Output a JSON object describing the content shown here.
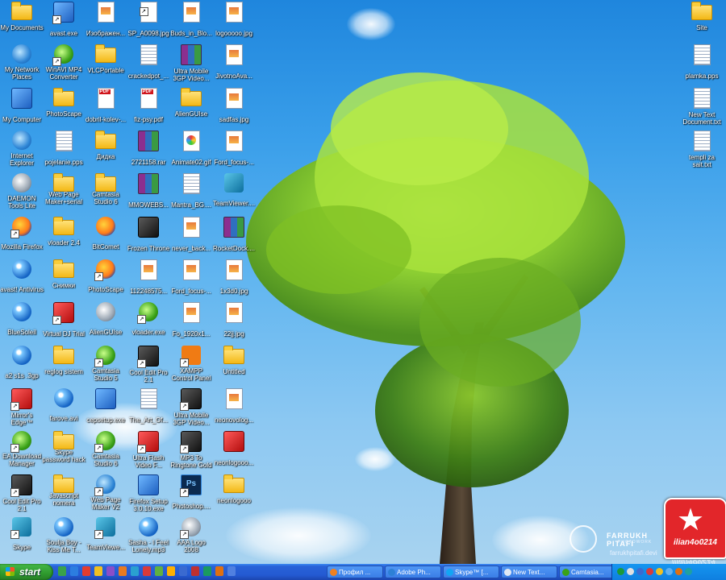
{
  "desktop_icons": [
    {
      "label": "My Documents",
      "glyph": "folder-icon",
      "col": 0,
      "row": 0
    },
    {
      "label": "avast.exe",
      "glyph": "exe-icon",
      "col": 1,
      "row": 0,
      "sc": true
    },
    {
      "label": "Изображен...",
      "glyph": "image-file-icon",
      "col": 2,
      "row": 0
    },
    {
      "label": "SP_A0098.jpg",
      "glyph": "image-file-icon",
      "col": 3,
      "row": 0,
      "sc": true
    },
    {
      "label": "Buds_in_Blo...",
      "glyph": "image-file-icon",
      "col": 4,
      "row": 0
    },
    {
      "label": "logooooo.jpg",
      "glyph": "image-file-icon",
      "col": 5,
      "row": 0
    },
    {
      "label": "My Network Places",
      "glyph": "network-icon",
      "col": 0,
      "row": 1
    },
    {
      "label": "WinAVI MP4 Converter",
      "glyph": "green-app-icon",
      "col": 1,
      "row": 1,
      "sc": true
    },
    {
      "label": "VLCPortable",
      "glyph": "folder-icon",
      "col": 2,
      "row": 1
    },
    {
      "label": "crackedpot_...",
      "glyph": "text-file-icon",
      "col": 3,
      "row": 1
    },
    {
      "label": "Ultra Mobile 3GP Video...",
      "glyph": "archive-icon",
      "col": 4,
      "row": 1
    },
    {
      "label": "JivotnoAva...",
      "glyph": "image-file-icon",
      "col": 5,
      "row": 1
    },
    {
      "label": "My Computer",
      "glyph": "computer-icon",
      "col": 0,
      "row": 2
    },
    {
      "label": "PhotoScape",
      "glyph": "folder-icon",
      "col": 1,
      "row": 2
    },
    {
      "label": "dobril-kolev-...",
      "glyph": "pdf-icon",
      "col": 2,
      "row": 2
    },
    {
      "label": "fiz-psy.pdf",
      "glyph": "pdf-icon",
      "col": 3,
      "row": 2
    },
    {
      "label": "AlienGUIse",
      "glyph": "folder-icon",
      "col": 4,
      "row": 2
    },
    {
      "label": "sadfas.jpg",
      "glyph": "image-file-icon",
      "col": 5,
      "row": 2
    },
    {
      "label": "Internet Explorer",
      "glyph": "ie-icon",
      "col": 0,
      "row": 3
    },
    {
      "label": "pojelanie.pps",
      "glyph": "pps-icon",
      "col": 1,
      "row": 3
    },
    {
      "label": "Дидка",
      "glyph": "folder-icon",
      "col": 2,
      "row": 3
    },
    {
      "label": "2721158.rar",
      "glyph": "archive-icon",
      "col": 3,
      "row": 3
    },
    {
      "label": "Animate02.gif",
      "glyph": "gif-icon",
      "col": 4,
      "row": 3
    },
    {
      "label": "Ford_focus-...",
      "glyph": "image-file-icon",
      "col": 5,
      "row": 3
    },
    {
      "label": "DAEMON Tools Lite",
      "glyph": "daemon-icon",
      "col": 0,
      "row": 4
    },
    {
      "label": "Web Page Maker+serial",
      "glyph": "folder-icon",
      "col": 1,
      "row": 4
    },
    {
      "label": "Camtasia Studio 6",
      "glyph": "folder-icon",
      "col": 2,
      "row": 4
    },
    {
      "label": "MMOWEBS...",
      "glyph": "archive-icon",
      "col": 3,
      "row": 4
    },
    {
      "label": "Mantra_BG....",
      "glyph": "text-file-icon",
      "col": 4,
      "row": 4
    },
    {
      "label": "TeamViewer....",
      "glyph": "teamviewer-icon",
      "col": 5,
      "row": 4
    },
    {
      "label": "Mozilla Firefox",
      "glyph": "firefox-icon",
      "col": 0,
      "row": 5,
      "sc": true
    },
    {
      "label": "vloader 2.4",
      "glyph": "folder-icon",
      "col": 1,
      "row": 5
    },
    {
      "label": "BitComet",
      "glyph": "bitcomet-icon",
      "col": 2,
      "row": 5
    },
    {
      "label": "Frozen Throne",
      "glyph": "game-icon",
      "col": 3,
      "row": 5
    },
    {
      "label": "never_back...",
      "glyph": "image-file-icon",
      "col": 4,
      "row": 5
    },
    {
      "label": "RocketDock....",
      "glyph": "archive-icon",
      "col": 5,
      "row": 5
    },
    {
      "label": "avast! Antivirus",
      "glyph": "avast-icon",
      "col": 0,
      "row": 6
    },
    {
      "label": "Снимки",
      "glyph": "folder-icon",
      "col": 1,
      "row": 6
    },
    {
      "label": "PhotoScape",
      "glyph": "photoscape-icon",
      "col": 2,
      "row": 6,
      "sc": true
    },
    {
      "label": "112248575...",
      "glyph": "image-file-icon",
      "col": 3,
      "row": 6
    },
    {
      "label": "Ford_focus-...",
      "glyph": "image-file-icon",
      "col": 4,
      "row": 6
    },
    {
      "label": "1x3d0.jpg",
      "glyph": "image-file-icon",
      "col": 5,
      "row": 6
    },
    {
      "label": "BlueSoleil",
      "glyph": "bluetooth-icon",
      "col": 0,
      "row": 7
    },
    {
      "label": "Virtual DJ Trial",
      "glyph": "red-app-icon",
      "col": 1,
      "row": 7,
      "sc": true
    },
    {
      "label": "AlienGUIse",
      "glyph": "alien-icon",
      "col": 2,
      "row": 7
    },
    {
      "label": "vloader.exe",
      "glyph": "green-app-icon",
      "col": 3,
      "row": 7,
      "sc": true
    },
    {
      "label": "Fo_1920x1...",
      "glyph": "image-file-icon",
      "col": 4,
      "row": 7
    },
    {
      "label": "22jj.jpg",
      "glyph": "image-file-icon",
      "col": 5,
      "row": 7
    },
    {
      "label": "a2 s1s .3gp",
      "glyph": "media-icon",
      "col": 0,
      "row": 8
    },
    {
      "label": "reglog sistem",
      "glyph": "folder-icon",
      "col": 1,
      "row": 8
    },
    {
      "label": "Camtasia Studio 5",
      "glyph": "camtasia-icon",
      "col": 2,
      "row": 8,
      "sc": true
    },
    {
      "label": "Cool Edit Pro 2.1",
      "glyph": "cooledit-icon",
      "col": 3,
      "row": 8,
      "sc": true
    },
    {
      "label": "XAMPP Control Panel",
      "glyph": "xampp-icon",
      "col": 4,
      "row": 8,
      "sc": true
    },
    {
      "label": "Untitled",
      "glyph": "folder-icon",
      "col": 5,
      "row": 8
    },
    {
      "label": "Mirror's Edge™",
      "glyph": "red-app-icon",
      "col": 0,
      "row": 9,
      "sc": true
    },
    {
      "label": "farove.avi",
      "glyph": "media-icon",
      "col": 1,
      "row": 9
    },
    {
      "label": "cepsetup.exe",
      "glyph": "exe-icon",
      "col": 2,
      "row": 9
    },
    {
      "label": "The_Art_Of...",
      "glyph": "text-file-icon",
      "col": 3,
      "row": 9
    },
    {
      "label": "Ultra Mobile 3GP Video...",
      "glyph": "phone-icon",
      "col": 4,
      "row": 9,
      "sc": true
    },
    {
      "label": "neonovolog...",
      "glyph": "image-file-icon",
      "col": 5,
      "row": 9
    },
    {
      "label": "EA Download Manager",
      "glyph": "ea-icon",
      "col": 0,
      "row": 10,
      "sc": true
    },
    {
      "label": "Skype password hack",
      "glyph": "folder-icon",
      "col": 1,
      "row": 10
    },
    {
      "label": "Camtasia Studio 6",
      "glyph": "camtasia-icon",
      "col": 2,
      "row": 10,
      "sc": true
    },
    {
      "label": "Ultra Flash Video F...",
      "glyph": "red-app-icon",
      "col": 3,
      "row": 10,
      "sc": true
    },
    {
      "label": "MP3 To Ringtone Gold",
      "glyph": "phone-icon",
      "col": 4,
      "row": 10,
      "sc": true
    },
    {
      "label": "neonlogooo...",
      "glyph": "red-app-icon",
      "col": 5,
      "row": 10
    },
    {
      "label": "Cool Edit Pro 2.1",
      "glyph": "cooledit-icon",
      "col": 0,
      "row": 11,
      "sc": true
    },
    {
      "label": "Javascript nomera",
      "glyph": "folder-icon",
      "col": 1,
      "row": 11
    },
    {
      "label": "Web Page Maker V2",
      "glyph": "web-icon",
      "col": 2,
      "row": 11,
      "sc": true
    },
    {
      "label": "Firefox Setup 3.0.10.exe",
      "glyph": "exe-icon",
      "col": 3,
      "row": 11
    },
    {
      "label": "Photoshop....",
      "glyph": "photoshop-icon",
      "col": 4,
      "row": 11,
      "sc": true
    },
    {
      "label": "neonlogooo",
      "glyph": "folder-icon",
      "col": 5,
      "row": 11
    },
    {
      "label": "Skype",
      "glyph": "skype-icon",
      "col": 0,
      "row": 12,
      "sc": true
    },
    {
      "label": "Soulja Boy - Kiss Me T...",
      "glyph": "media-icon",
      "col": 1,
      "row": 12
    },
    {
      "label": "TeamViewe...",
      "glyph": "teamviewer-icon",
      "col": 2,
      "row": 12,
      "sc": true
    },
    {
      "label": "Sasha - I Feel Lonely.mp3",
      "glyph": "media-icon",
      "col": 3,
      "row": 12
    },
    {
      "label": "AAA Logo 2008",
      "glyph": "gray-app-icon",
      "col": 4,
      "row": 12,
      "sc": true
    }
  ],
  "right_icons": [
    {
      "label": "Site",
      "glyph": "folder-icon",
      "row": 0
    },
    {
      "label": "plamka.pps",
      "glyph": "pps-icon",
      "row": 1
    },
    {
      "label": "New Text Document.txt",
      "glyph": "text-file-icon",
      "row": 2
    },
    {
      "label": "templi za sait.txt",
      "glyph": "text-file-icon",
      "row": 3
    }
  ],
  "watermark": {
    "name": "FARRUKH PITAFI",
    "sub": "PHOTOWORK",
    "site": "farrukhpitafi.devi"
  },
  "logo": {
    "text": "ilian4o0214"
  },
  "taskbar": {
    "start_label": "start",
    "quick_launch": [
      "#3aa24a",
      "#2c7de0",
      "#e33c2f",
      "#f0c020",
      "#8a4ec8",
      "#e77a20",
      "#2aa0d0",
      "#d93a3a",
      "#60b040",
      "#ffb000",
      "#3a6ad0",
      "#c03030",
      "#1a9a60",
      "#e07010",
      "#5080e0"
    ],
    "buttons": [
      {
        "label": "Профил ...",
        "icon": "firefox-icon",
        "color": "#f08020"
      },
      {
        "label": "Adobe Ph...",
        "icon": "photoshop-icon",
        "color": "#2d80d6"
      },
      {
        "label": "Skype™ [...",
        "icon": "skype-icon",
        "color": "#12a5f4"
      },
      {
        "label": "New Text...",
        "icon": "notepad-icon",
        "color": "#dfe8f5"
      },
      {
        "label": "Camtasia...",
        "icon": "camtasia-icon",
        "color": "#3aa218"
      }
    ],
    "tray": [
      "#1a9a3a",
      "#e0e0e0",
      "#3a6ad0",
      "#d93a3a",
      "#f0c020",
      "#60b0f0",
      "#e07010",
      "#20a0a0"
    ]
  }
}
